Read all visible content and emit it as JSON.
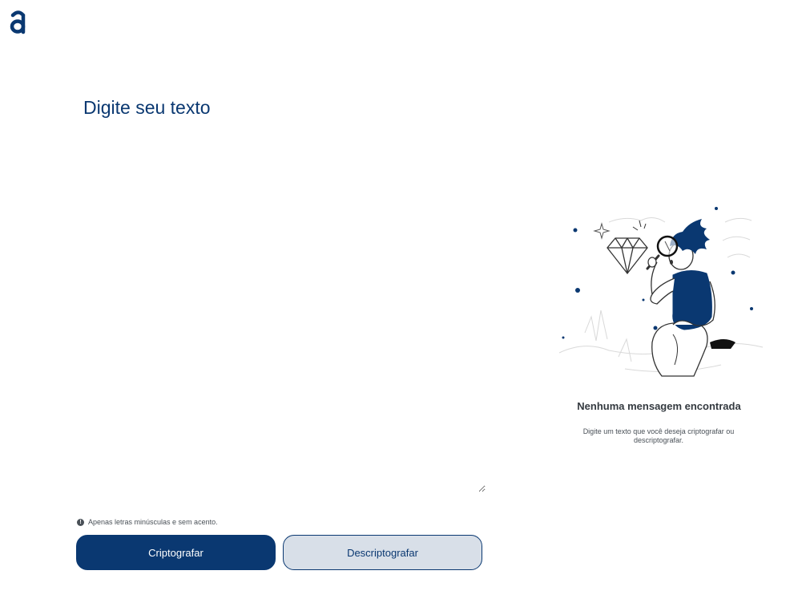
{
  "brand": {
    "logo_icon": "alura-a-logo-icon",
    "primary_color": "#0A3871",
    "secondary_bg": "#D8DFE8"
  },
  "input": {
    "placeholder": "Digite seu texto",
    "value": ""
  },
  "hint": {
    "icon": "info-icon",
    "text": "Apenas letras minúsculas e sem acento."
  },
  "buttons": {
    "encrypt_label": "Criptografar",
    "decrypt_label": "Descriptografar"
  },
  "output": {
    "illustration": "person-with-magnifying-glass-illustration",
    "title": "Nenhuma mensagem encontrada",
    "description": "Digite um texto que você deseja criptografar ou descriptografar."
  }
}
